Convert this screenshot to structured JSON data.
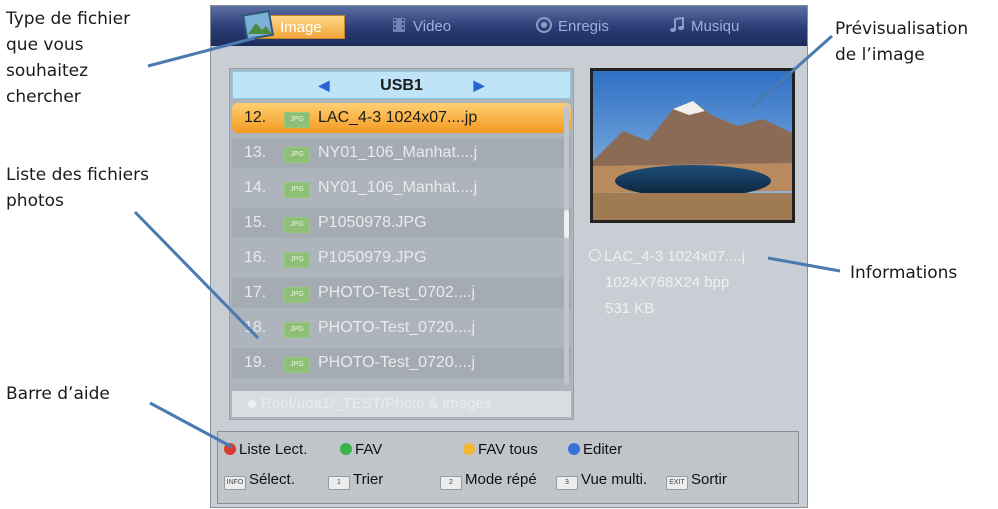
{
  "annotations": {
    "file_type": [
      "Type de fichier",
      "que vous",
      "souhaitez",
      "chercher"
    ],
    "file_list": [
      "Liste des fichiers",
      "photos"
    ],
    "help_bar": "Barre d’aide",
    "preview": [
      "Prévisualisation",
      "de l’image"
    ],
    "info": "Informations"
  },
  "tabs": [
    {
      "label": "Image",
      "active": true
    },
    {
      "label": "Video",
      "active": false
    },
    {
      "label": "Enregis",
      "active": false
    },
    {
      "label": "Musiqu",
      "active": false
    }
  ],
  "device": "USB1",
  "files": [
    {
      "num": "12.",
      "name": "LAC_4-3 1024x07....jp",
      "selected": true
    },
    {
      "num": "13.",
      "name": "NY01_106_Manhat....j"
    },
    {
      "num": "14.",
      "name": "NY01_106_Manhat....j"
    },
    {
      "num": "15.",
      "name": "P1050978.JPG"
    },
    {
      "num": "16.",
      "name": "P1050979.JPG"
    },
    {
      "num": "17.",
      "name": "PHOTO-Test_0702....j"
    },
    {
      "num": "18.",
      "name": "PHOTO-Test_0720....j"
    },
    {
      "num": "19.",
      "name": "PHOTO-Test_0720....j"
    }
  ],
  "file_badge": "JPG",
  "path": "Root/uda1/_TEST/Photo & images",
  "info": {
    "filename": "LAC_4-3 1024x07....j",
    "resolution": "1024X768X24 bpp",
    "size": "531 KB"
  },
  "help": {
    "red": "Liste Lect.",
    "green": "FAV",
    "yellow": "FAV tous",
    "blue": "Editer",
    "info_key": "INFO",
    "info": "Sélect.",
    "key1_icon": "1",
    "key1": "Trier",
    "key2_icon": "2",
    "key2": "Mode répé",
    "key3_icon": "3",
    "key3": "Vue multi.",
    "exit_key": "EXIT",
    "exit": "Sortir"
  },
  "colors": {
    "red": "#d83a2e",
    "green": "#3bb34a",
    "yellow": "#f2b631",
    "blue": "#3a70d9"
  }
}
